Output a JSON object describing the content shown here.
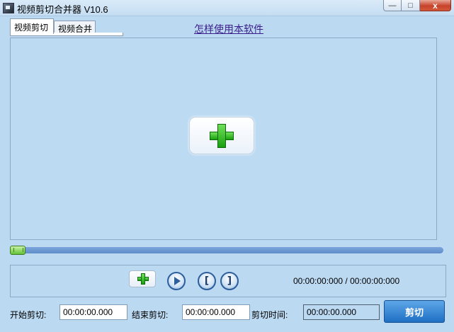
{
  "window": {
    "title": "视频剪切合并器 V10.6",
    "minimize_glyph": "—",
    "maximize_glyph": "□",
    "close_glyph": "x"
  },
  "tabs": [
    {
      "label": "视频剪切",
      "active": true
    },
    {
      "label": "视频合并",
      "active": false
    }
  ],
  "help_link": "怎样使用本软件",
  "preview": {
    "add_icon": "green-plus-icon"
  },
  "seek": {
    "progress": 0
  },
  "controls": {
    "add_icon": "green-plus-icon",
    "play_icon": "play-icon",
    "mark_start_glyph": "[",
    "mark_end_glyph": "]",
    "time_display": "00:00:00:000 / 00:00:00:000"
  },
  "cut_settings": {
    "start_label": "开始剪切:",
    "start_value": "00:00:00.000",
    "end_label": "结束剪切:",
    "end_value": "00:00:00.000",
    "duration_label": "剪切时间:",
    "duration_value": "00:00:00.000",
    "cut_button": "剪切"
  },
  "colors": {
    "background": "#bcd9f2",
    "accent": "#1f6fc4",
    "plus_green": "#19a00d"
  }
}
